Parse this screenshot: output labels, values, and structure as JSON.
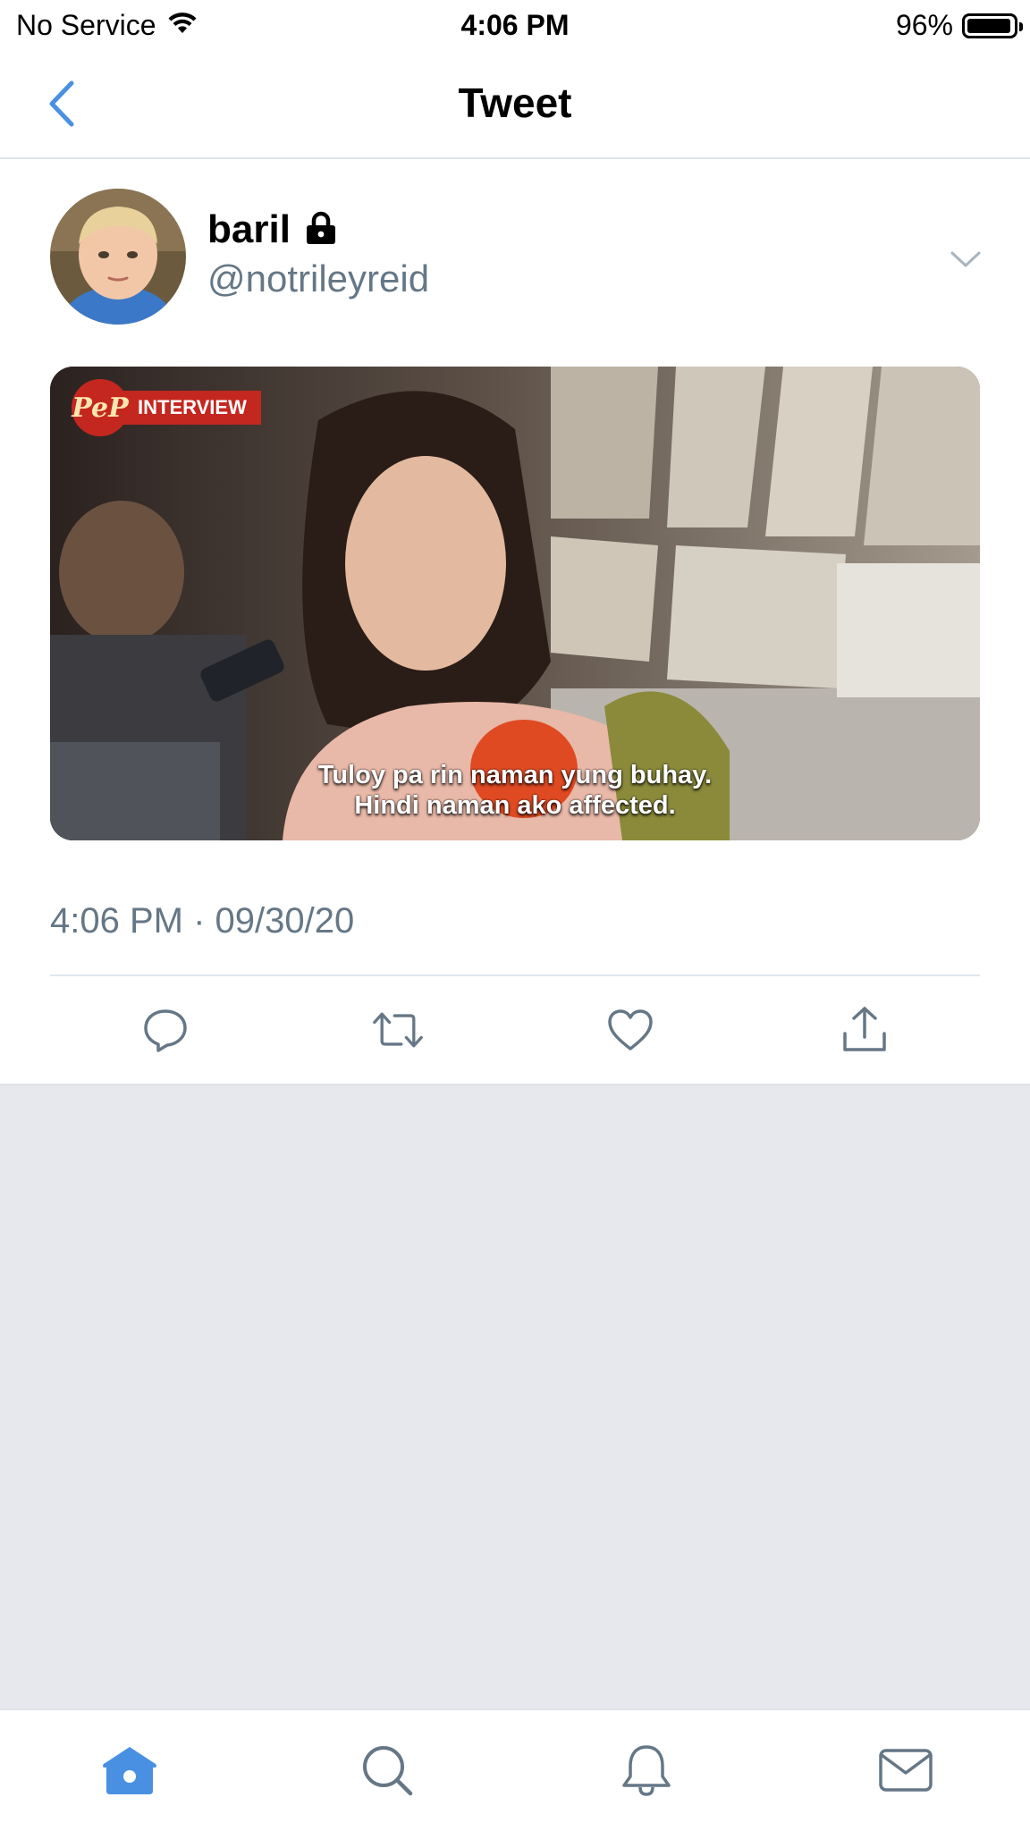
{
  "status_bar": {
    "carrier": "No Service",
    "time": "4:06 PM",
    "battery_text": "96%",
    "battery_level": 0.96
  },
  "nav": {
    "title": "Tweet",
    "back_icon": "chevron-left-icon"
  },
  "tweet": {
    "display_name": "baril",
    "protected_icon": "lock-icon",
    "handle": "@notrileyreid",
    "media": {
      "logo_text": "PeP",
      "badge_text": "INTERVIEW",
      "caption_line1": "Tuloy pa rin naman yung buhay.",
      "caption_line2": "Hindi naman ako affected."
    },
    "timestamp": "4:06 PM · 09/30/20"
  },
  "actions": {
    "reply_icon": "reply-icon",
    "retweet_icon": "retweet-icon",
    "like_icon": "heart-icon",
    "share_icon": "share-icon"
  },
  "tab_bar": {
    "items": [
      "home-icon",
      "search-icon",
      "notifications-icon",
      "messages-icon"
    ],
    "active": "home-icon"
  },
  "colors": {
    "accent": "#4a90e2",
    "secondary_text": "#657786",
    "icon_gray": "#657786",
    "gray_background": "#e6e8ee"
  }
}
